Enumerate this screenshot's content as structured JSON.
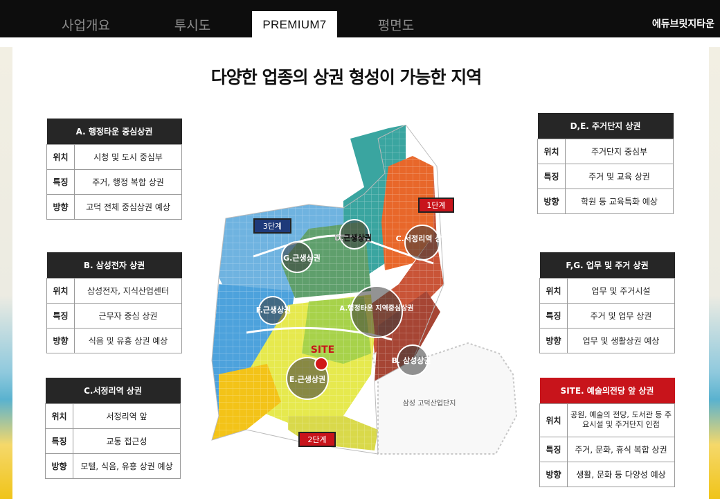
{
  "nav": {
    "tabs": [
      {
        "label": "사업개요"
      },
      {
        "label": "투시도"
      },
      {
        "label": "PREMIUM7"
      },
      {
        "label": "평면도"
      }
    ],
    "brand": "에듀브릿지타운"
  },
  "page": {
    "title": "다양한 업종의 상권 형성이 가능한 지역"
  },
  "row_labels": {
    "location": "위치",
    "feature": "특징",
    "direction": "방향"
  },
  "tables": {
    "a": {
      "title": "A. 행정타운 중심상권",
      "location": "시청 및 도시 중심부",
      "feature": "주거, 행정 복합 상권",
      "direction": "고덕 전체 중심상권 예상"
    },
    "b": {
      "title": "B. 삼성전자 상권",
      "location": "삼성전자, 지식산업센터",
      "feature": "근무자 중심 상권",
      "direction": "식음 및 유흥 상권 예상"
    },
    "c": {
      "title": "C.서정리역 상권",
      "location": "서정리역 앞",
      "feature": "교통 접근성",
      "direction": "모텔, 식음, 유흥 상권 예상"
    },
    "de": {
      "title": "D,E. 주거단지 상권",
      "location": "주거단지 중심부",
      "feature": "주거 및 교육 상권",
      "direction": "학원 등 교육특화 예상"
    },
    "fg": {
      "title": "F,G. 업무 및 주거 상권",
      "location": "업무 및 주거시설",
      "feature": "주거 및 업무 상권",
      "direction": "업무 및 생활상권 예상"
    },
    "site": {
      "title": "SITE. 예술의전당 앞 상권",
      "location": "공원, 예술의 전당, 도서관 등 주요시설 및 주거단지 인접",
      "feature": "주거, 문화, 휴식 복합 상권",
      "direction": "생활, 문화 등 다양성 예상"
    }
  },
  "map": {
    "phases": {
      "p1": "1단계",
      "p2": "2단계",
      "p3": "3단계"
    },
    "circles": {
      "a": "A.행정타운 지역중심상권",
      "b": "B. 삼성상권",
      "c": "C.서정리역 상권",
      "d": "D.근생상권",
      "e": "E.근생상권",
      "f": "F.근생상권",
      "g": "G.근생상권"
    },
    "site_label": "SITE",
    "samsung_label": "삼성 고덕산업단지",
    "colors": {
      "phase1": "#c8141b",
      "phase2": "#c8141b",
      "phase3": "#1f3a7a",
      "site": "#d01818"
    }
  }
}
